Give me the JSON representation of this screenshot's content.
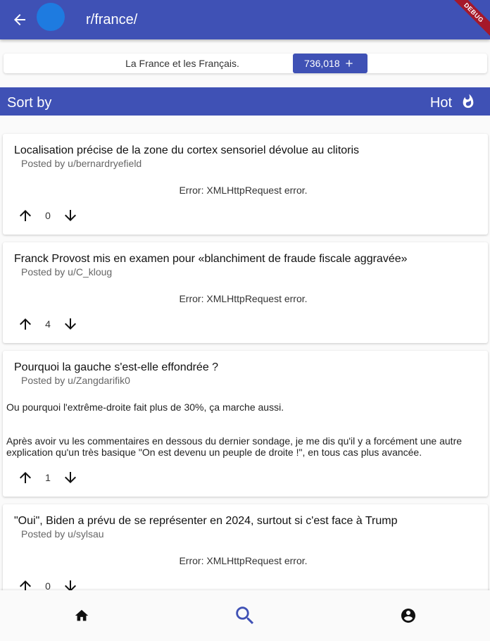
{
  "appbar": {
    "title": "r/france/",
    "debug_banner": "DEBUG",
    "back_icon": "arrow-back-icon",
    "color": "#3f51b5",
    "avatar_color": "#1e7be0"
  },
  "subreddit": {
    "description": "La France et les Français.",
    "subscribers": "736,018",
    "subscribe_icon": "plus-icon"
  },
  "sort": {
    "label": "Sort by",
    "value": "Hot",
    "icon": "fire-icon"
  },
  "posts": [
    {
      "title": "Localisation précise de la zone du cortex sensoriel dévolue au clitoris",
      "author": "Posted by u/bernardryefield",
      "error": "Error: XMLHttpRequest error.",
      "votes": "0"
    },
    {
      "title": "Franck Provost mis en examen pour «blanchiment de fraude fiscale aggravée»",
      "author": "Posted by u/C_kloug",
      "error": "Error: XMLHttpRequest error.",
      "votes": "4"
    },
    {
      "title": "Pourquoi la gauche s'est-elle effondrée ?",
      "author": "Posted by u/Zangdarifik0",
      "body_1": "Ou pourquoi l'extrême-droite fait plus de 30%, ça marche aussi.",
      "body_2": "Après avoir vu les commentaires en dessous du dernier sondage, je me dis qu'il y a forcément une autre explication qu'un très basique \"On est devenu un peuple de droite !\", en tous cas plus avancée.",
      "votes": "1"
    },
    {
      "title": "\"Oui\", Biden a prévu de se représenter en 2024, surtout si c'est face à Trump",
      "author": "Posted by u/sylsau",
      "error": "Error: XMLHttpRequest error.",
      "votes": "0"
    }
  ],
  "bottom_nav": {
    "items": [
      "home-icon",
      "search-icon",
      "account-circle-icon"
    ],
    "active": "search-icon",
    "active_color": "#3f51b5"
  }
}
